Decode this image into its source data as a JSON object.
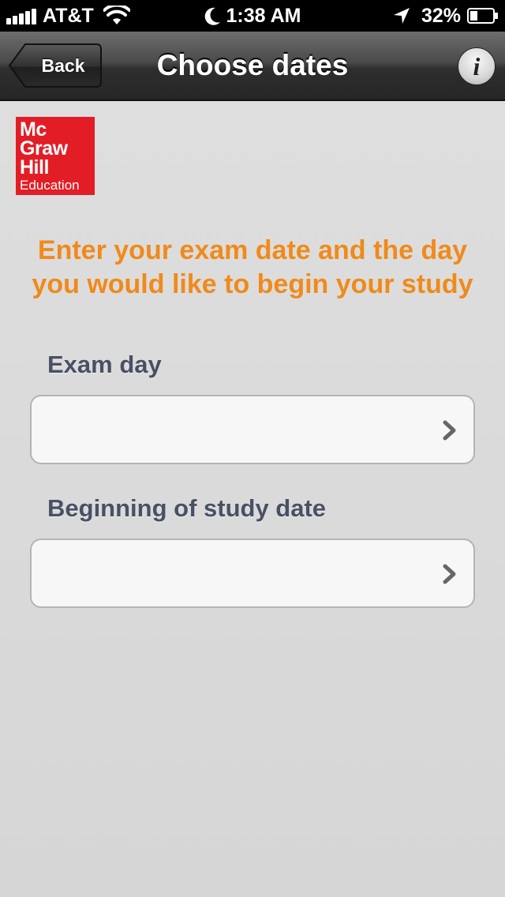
{
  "status_bar": {
    "carrier": "AT&T",
    "time": "1:38 AM",
    "battery_percent": "32%",
    "battery_level": 0.32,
    "icons": [
      "signal-icon",
      "wifi-icon",
      "moon-icon",
      "location-icon",
      "battery-icon"
    ]
  },
  "nav": {
    "back_label": "Back",
    "title": "Choose dates",
    "info_glyph": "i"
  },
  "logo": {
    "lines": [
      "Mc",
      "Graw",
      "Hill",
      "Education"
    ],
    "color": "#e21d26"
  },
  "instruction": {
    "line1": "Enter your exam date and the day",
    "line2": "you would like to begin your study"
  },
  "fields": [
    {
      "label": "Exam day",
      "value": ""
    },
    {
      "label": "Beginning of study date",
      "value": ""
    }
  ],
  "colors": {
    "accent": "#f08a1a",
    "label": "#4a5064",
    "nav_bg": "#3a3a3a"
  }
}
